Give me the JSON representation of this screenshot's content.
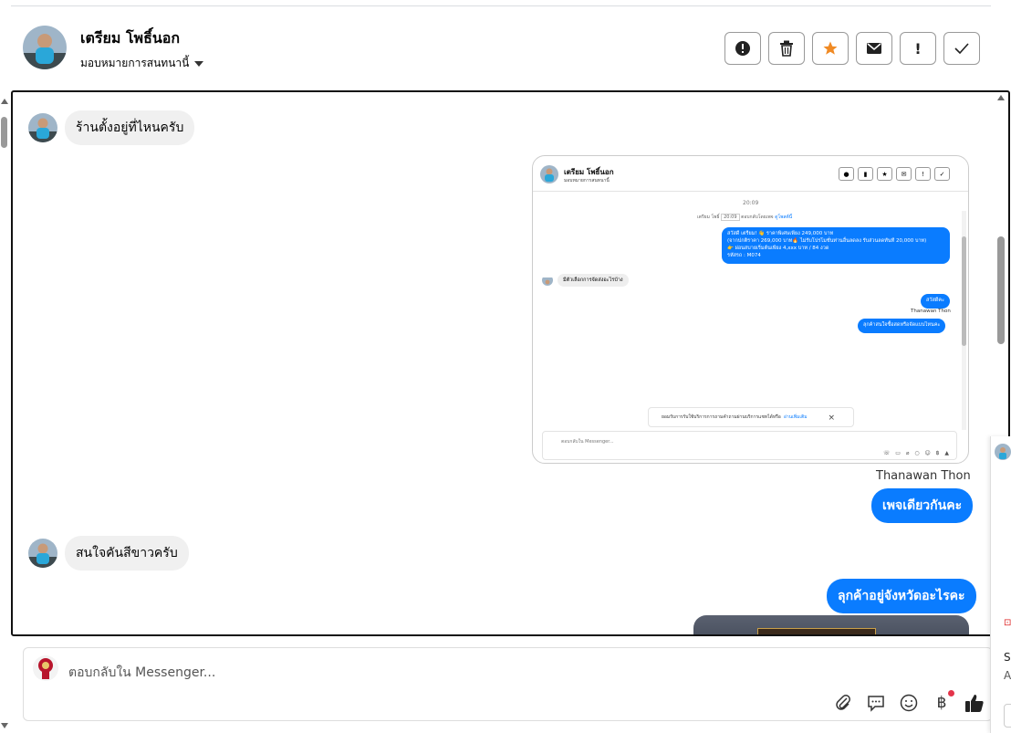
{
  "header": {
    "contact_name": "เตรียม โพธิ์นอก",
    "assign_label": "มอบหมายการสนทนานี้",
    "actions": [
      {
        "name": "alert-icon",
        "glyph": "⬤"
      },
      {
        "name": "trash-icon",
        "glyph": "🗑"
      },
      {
        "name": "star-icon",
        "glyph": "★"
      },
      {
        "name": "mail-icon",
        "glyph": "✉"
      },
      {
        "name": "exclaim-icon",
        "glyph": "!"
      },
      {
        "name": "check-icon",
        "glyph": "✓"
      }
    ]
  },
  "messages": {
    "m1": "ร้านตั้งอยู่ที่ไหนครับ",
    "sender_out": "Thanawan Thon",
    "m2": "เพจเดียวกันคะ",
    "m3": "สนใจคันสีขาวครับ",
    "m4": "ลุกค้าอยู่จังหวัดอะไรคะ"
  },
  "embedded_screenshot": {
    "name": "เตรียม โพธิ์นอก",
    "sub": "มอบหมายการสนทนานี้",
    "time": "20:09",
    "note_prefix": "เตรียม โพธิ์",
    "note_time": "20:09",
    "note_mid": "ตอบกลับโดยเพจ",
    "note_link": "ดูโพสต์นี้",
    "offer_lines": [
      "สวัสดี เตรียม! 👋 ราคาพิเศษเพียง 249,000 บาท",
      "(จากปกติราคา 269,000 บาท🔥 ไม่รับโปรโมชั่นท่านอื่นลดลง รับส่วนลดทันที 20,000 บาท)",
      "👉 ผ่อนสบายเริ่มต้นเพียง 4,xxx บาท / 84 งวด",
      "รหัสรถ : M074"
    ],
    "in_msg": "มีตัวเลือกการจัดส่งอะไรบ้าง",
    "out1": "สวัสดีคะ",
    "out_sender": "Thanawan Thon",
    "out2": "ลุกค้าสนใจซื้อสดหรือจัดแบบไหนคะ",
    "banner_text": "ยอมรับการรับใช้บริการการถามคำถามผ่านบริการแชทได้หรือ",
    "banner_link": "อ่านเพิ่มเติม",
    "input_placeholder": "ตอบกลับใน Messenger..."
  },
  "composer": {
    "placeholder": "ตอบกลับใน Messenger...",
    "tools": [
      "paperclip-icon",
      "speech-bubble-icon",
      "smiley-icon",
      "baht-icon",
      "thumbs-up-icon"
    ],
    "baht_glyph": "฿"
  },
  "side_panel": {
    "letter_s": "S",
    "letter_a": "A"
  }
}
